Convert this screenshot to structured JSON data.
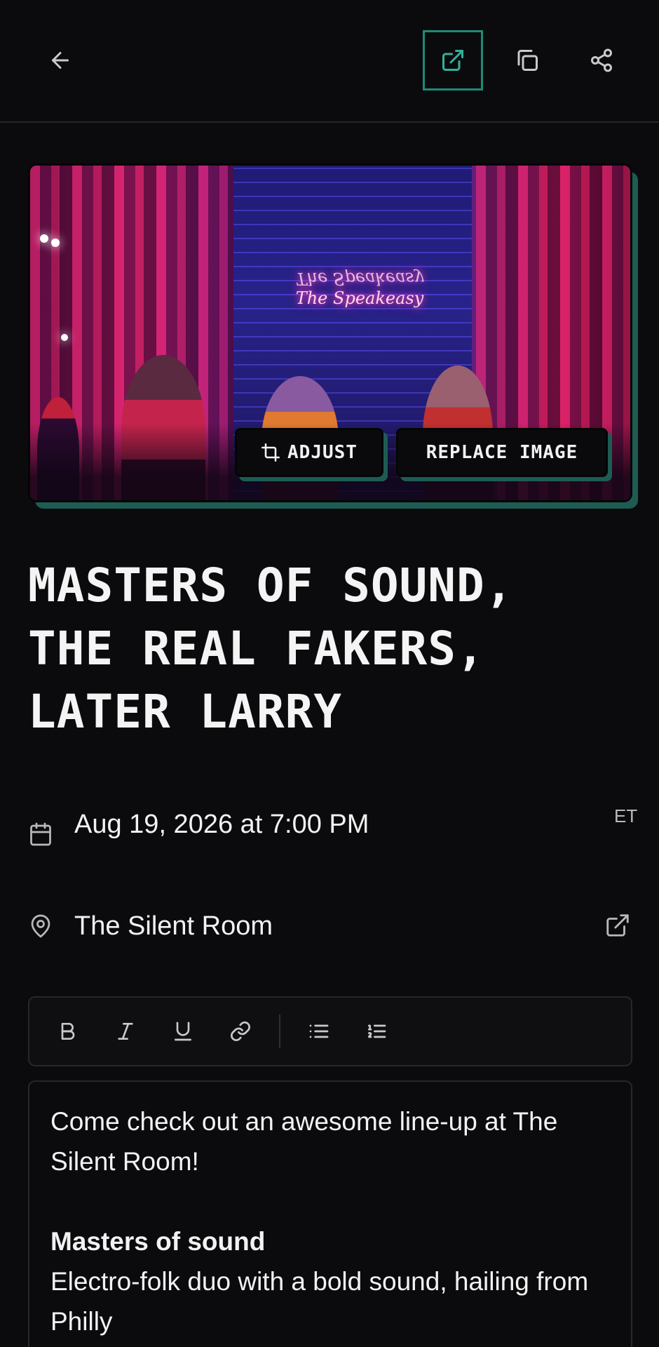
{
  "toolbar_top": {
    "back_icon": "arrow-left-icon",
    "open_icon": "external-link-icon",
    "copy_icon": "copy-icon",
    "share_icon": "share-icon",
    "active_accent": "#1f8a77"
  },
  "hero": {
    "neon_sign": "The Speakeasy",
    "adjust_label": "ADJUST",
    "replace_label": "REPLACE IMAGE",
    "shadow_color": "#1e5c53"
  },
  "event": {
    "title_lines": [
      "MASTERS OF SOUND,",
      "THE REAL FAKERS,",
      "LATER LARRY"
    ],
    "datetime": "Aug 19, 2026 at 7:00 PM",
    "timezone": "ET",
    "venue": "The Silent Room"
  },
  "editor_toolbar": {
    "items": [
      "bold-icon",
      "italic-icon",
      "underline-icon",
      "link-icon",
      "bullet-list-icon",
      "numbered-list-icon"
    ]
  },
  "description": {
    "intro": "Come check out an awesome line-up at The Silent Room!",
    "band_name": "Masters of sound",
    "band_desc": "Electro-folk duo with a bold sound, hailing from Philly"
  }
}
